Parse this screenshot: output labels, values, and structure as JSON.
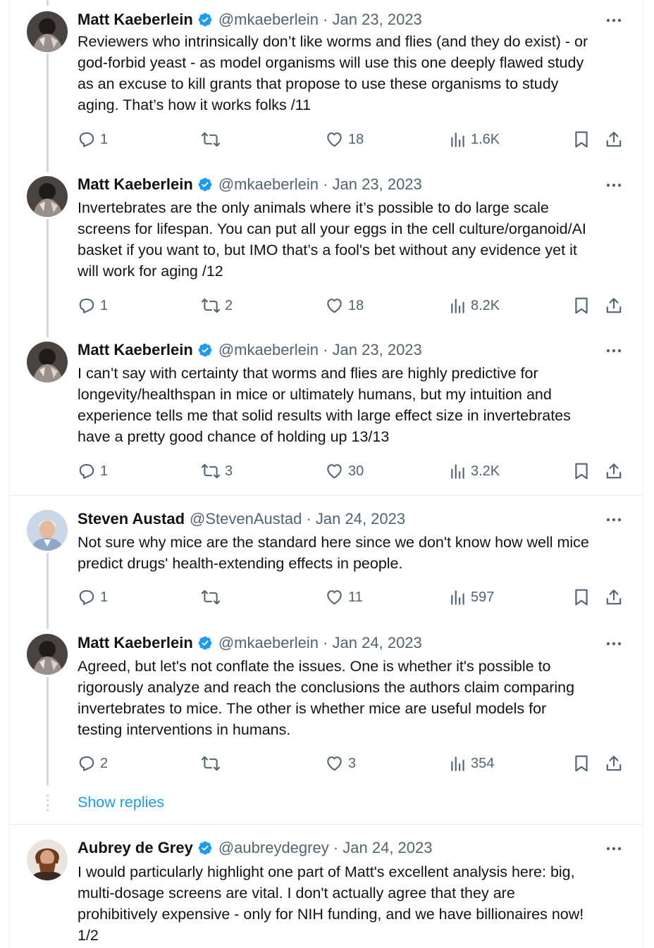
{
  "tweets": [
    {
      "name": "Matt Kaeberlein",
      "verified": true,
      "handle_date": "@mkaeberlein · Jan 23, 2023",
      "text": "Reviewers who intrinsically don’t like worms and flies (and they do exist) - or\ngod-forbid yeast - as model organisms will use this one deeply flawed study\nas an excuse to kill grants that propose to use these organisms to study\naging. That’s how it works folks /11",
      "replies": "1",
      "retweets": "",
      "likes": "18",
      "views": "1.6K"
    },
    {
      "name": "Matt Kaeberlein",
      "verified": true,
      "handle_date": "@mkaeberlein · Jan 23, 2023",
      "text": "Invertebrates are the only animals where it’s possible to do large scale\nscreens for lifespan. You can put all your eggs in the cell culture/organoid/AI\nbasket if you want to, but IMO that’s a fool's bet without any evidence yet it\nwill work for aging /12",
      "replies": "1",
      "retweets": "2",
      "likes": "18",
      "views": "8.2K"
    },
    {
      "name": "Matt Kaeberlein",
      "verified": true,
      "handle_date": "@mkaeberlein · Jan 23, 2023",
      "text": "I can’t say with certainty that worms and flies are highly predictive for\nlongevity/healthspan in mice or ultimately humans, but my intuition and\nexperience tells me that solid results with large effect size in invertebrates\nhave a pretty good chance of holding up 13/13",
      "replies": "1",
      "retweets": "3",
      "likes": "30",
      "views": "3.2K"
    },
    {
      "name": "Steven Austad",
      "verified": false,
      "handle_date": "@StevenAustad · Jan 24, 2023",
      "text": "Not sure why mice are the standard here since we don't know how well mice\npredict drugs' health-extending effects in people.",
      "replies": "1",
      "retweets": "",
      "likes": "11",
      "views": "597"
    },
    {
      "name": "Matt Kaeberlein",
      "verified": true,
      "handle_date": "@mkaeberlein · Jan 24, 2023",
      "text": "Agreed, but let's not conflate the issues.  One is whether it's possible to\nrigorously analyze and reach the conclusions the authors claim comparing\ninvertebrates to mice. The other is whether mice are useful models for\ntesting interventions in humans.",
      "replies": "2",
      "retweets": "",
      "likes": "3",
      "views": "354"
    },
    {
      "name": "Aubrey de Grey",
      "verified": true,
      "handle_date": "@aubreydegrey · Jan 24, 2023",
      "text": "I would particularly highlight one part of Matt's excellent analysis here: big,\nmulti-dosage screens are vital. I don't actually agree that they are\nprohibitively expensive - only for NIH funding, and we have billionaires now!\n1/2"
    }
  ],
  "show_replies": "Show replies",
  "colors": {
    "accent": "#1d9bf0",
    "muted": "#536471",
    "text": "#0f1419",
    "thread_line": "#cfd9de"
  },
  "icons": [
    "reply-icon",
    "retweet-icon",
    "like-icon",
    "views-icon",
    "bookmark-icon",
    "share-icon",
    "more-icon",
    "verified-badge-icon"
  ]
}
